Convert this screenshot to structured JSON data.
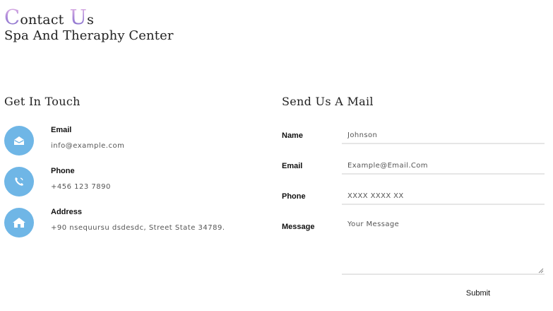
{
  "header": {
    "title_first_cap": "C",
    "title_first_rest": "ontact",
    "title_second_cap": "U",
    "title_second_rest": "s",
    "subtitle": "Spa And Theraphy Center"
  },
  "get_in_touch": {
    "title": "Get In Touch",
    "items": [
      {
        "label": "Email",
        "value": "info@example.com",
        "icon": "envelope-icon"
      },
      {
        "label": "Phone",
        "value": "+456 123 7890",
        "icon": "phone-icon"
      },
      {
        "label": "Address",
        "value": "+90 nsequursu dsdesdc, Street State 34789.",
        "icon": "home-icon"
      }
    ],
    "icon_color": "#6fb6e6"
  },
  "mail_form": {
    "title": "Send Us A Mail",
    "fields": [
      {
        "label": "Name",
        "placeholder": "Johnson"
      },
      {
        "label": "Email",
        "placeholder": "Example@Email.Com"
      },
      {
        "label": "Phone",
        "placeholder": "XXXX XXXX XX"
      },
      {
        "label": "Message",
        "placeholder": "Your Message"
      }
    ],
    "submit_label": "Submit"
  }
}
